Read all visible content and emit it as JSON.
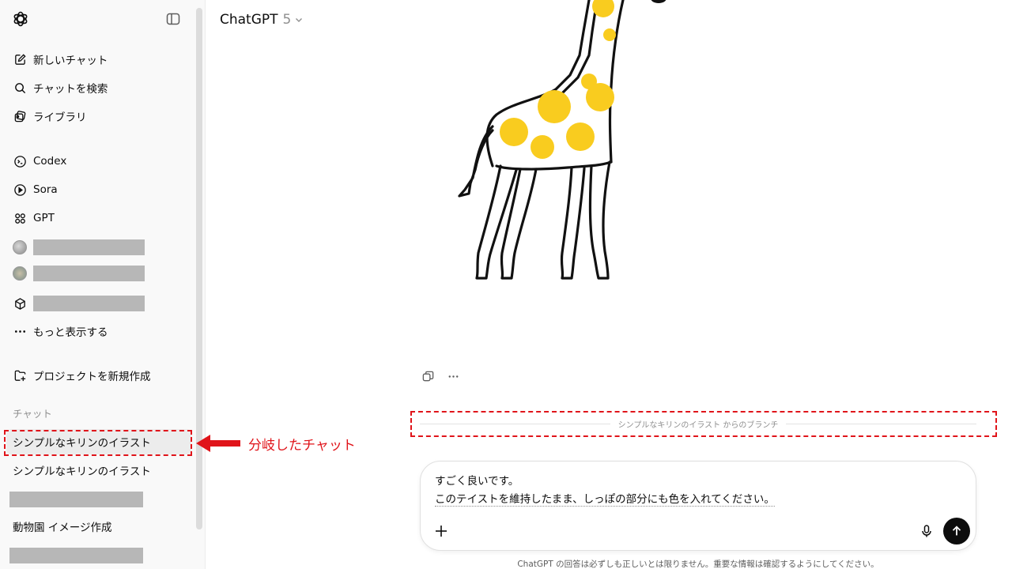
{
  "sidebar": {
    "nav": [
      {
        "label": "新しいチャット",
        "icon": "compose-icon"
      },
      {
        "label": "チャットを検索",
        "icon": "search-icon"
      },
      {
        "label": "ライブラリ",
        "icon": "library-icon"
      }
    ],
    "apps": [
      {
        "label": "Codex",
        "icon": "terminal-icon"
      },
      {
        "label": "Sora",
        "icon": "play-icon"
      },
      {
        "label": "GPT",
        "icon": "grid-icon"
      }
    ],
    "more_label": "もっと表示する",
    "new_project_label": "プロジェクトを新規作成",
    "section_title": "チャット",
    "chats": [
      {
        "label": "シンプルなキリンのイラスト",
        "active": true
      },
      {
        "label": "シンプルなキリンのイラスト",
        "active": false
      },
      {
        "label": "",
        "redacted": true
      },
      {
        "label": "動物園 イメージ作成",
        "active": false
      },
      {
        "label": "",
        "redacted": true
      }
    ]
  },
  "header": {
    "model_name": "ChatGPT",
    "model_version": "5"
  },
  "annotation": {
    "text": "分岐したチャット",
    "color": "#e0141a"
  },
  "branch": {
    "title": "シンプルなキリンのイラスト",
    "suffix": "からのブランチ"
  },
  "composer": {
    "line1": "すごく良いです。",
    "line2": "このテイストを維持したまま、しっぽの部分にも色を入れてください。"
  },
  "footer": {
    "text": "ChatGPT の回答は必ずしも正しいとは限りません。重要な情報は確認するようにしてください。"
  },
  "colors": {
    "spot": "#f9cc1f",
    "send_bg": "#0d0d0d",
    "sidebar_bg": "#f9f9f9"
  }
}
